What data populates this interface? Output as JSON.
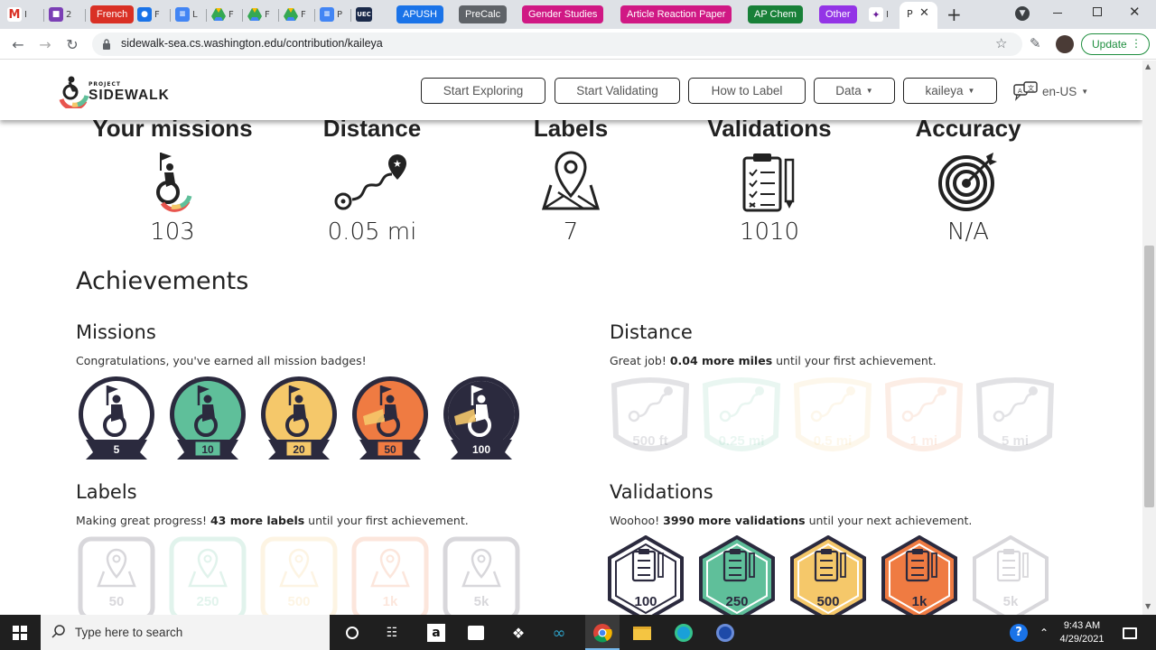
{
  "browser": {
    "tabs": {
      "gmail_fav": "M",
      "t2_fav": "",
      "t2_text": "2",
      "french": "French",
      "t4_text": "F",
      "t5_text": "L",
      "t6_text": "F",
      "t7_text": "F",
      "t8_text": "F",
      "t9_text": "P",
      "uec_fav": "UEC",
      "apush": "APUSH",
      "precalc": "PreCalc",
      "gender": "Gender Studies",
      "article": "Article Reaction Paper",
      "apchem": "AP Chem",
      "other": "Other",
      "t17_text": "I",
      "active_text": "P",
      "new_tab": "+"
    },
    "url": "sidewalk-sea.cs.washington.edu/contribution/kaileya",
    "update_label": "Update"
  },
  "colors": {
    "tab_french": "#d93025",
    "tab_apush": "#1a73e8",
    "tab_precalc": "#5f6368",
    "tab_gender": "#d01884",
    "tab_article": "#d01884",
    "tab_apchem": "#188038",
    "tab_other": "#9334e6",
    "badge_dark": "#2b2a3e",
    "badge_green": "#5fbf9a",
    "badge_yellow": "#f5c86a",
    "badge_orange": "#ef7b42"
  },
  "header": {
    "logo_small": "PROJECT",
    "logo_big": "SIDEWALK",
    "nav": {
      "explore": "Start Exploring",
      "validate": "Start Validating",
      "howto": "How to Label",
      "data": "Data",
      "user": "kaileya"
    },
    "lang": "en-US"
  },
  "stats": {
    "missions": {
      "title": "Your missions",
      "value": "103"
    },
    "distance": {
      "title": "Distance",
      "value": "0.05 mi"
    },
    "labels": {
      "title": "Labels",
      "value": "7"
    },
    "validations": {
      "title": "Validations",
      "value": "1010"
    },
    "accuracy": {
      "title": "Accuracy",
      "value": "N/A"
    }
  },
  "achievements": {
    "heading": "Achievements",
    "missions": {
      "title": "Missions",
      "msg": "Congratulations, you've earned all mission badges!",
      "badges": [
        "5",
        "10",
        "20",
        "50",
        "100"
      ]
    },
    "distance": {
      "title": "Distance",
      "msg_pre": "Great job! ",
      "msg_bold": "0.04 more miles",
      "msg_post": " until your first achievement.",
      "badges": [
        "500 ft",
        "0.25 mi",
        "0.5 mi",
        "1 mi",
        "5 mi"
      ]
    },
    "labels": {
      "title": "Labels",
      "msg_pre": "Making great progress! ",
      "msg_bold": "43 more labels",
      "msg_post": " until your first achievement.",
      "badges": [
        "50",
        "250",
        "500",
        "1k",
        "5k"
      ]
    },
    "validations": {
      "title": "Validations",
      "msg_pre": "Woohoo! ",
      "msg_bold": "3990 more validations",
      "msg_post": " until your next achievement.",
      "badges": [
        "100",
        "250",
        "500",
        "1k",
        "5k"
      ]
    }
  },
  "taskbar": {
    "search_placeholder": "Type here to search",
    "time": "9:43 AM",
    "date": "4/29/2021"
  }
}
